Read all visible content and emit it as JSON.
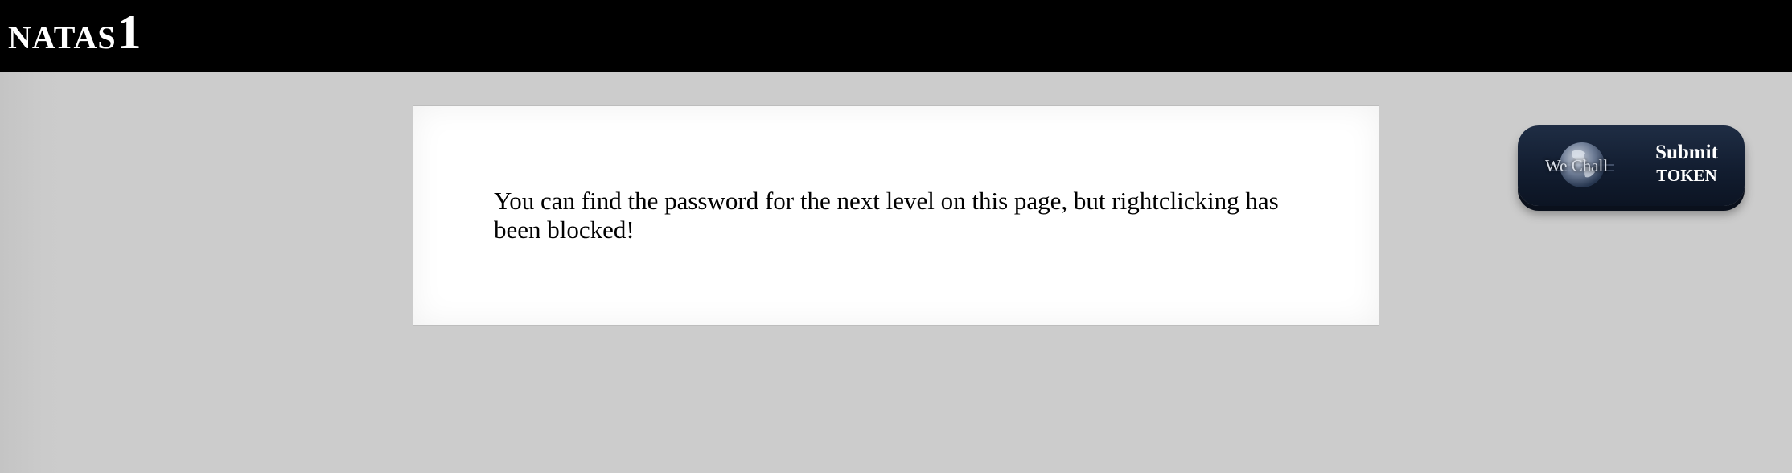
{
  "header": {
    "site_title": "NATAS",
    "level_number": "1"
  },
  "content": {
    "message": "You can find the password for the next level on this page, but rightclicking has been blocked!"
  },
  "wechall": {
    "logo_text": "We Chall",
    "submit_line1": "Submit",
    "submit_line2": "TOKEN",
    "icon": "globe-icon"
  },
  "colors": {
    "header_bg": "#000000",
    "page_bg": "#cccccc",
    "card_bg": "#ffffff",
    "button_bg": "#16223a"
  }
}
